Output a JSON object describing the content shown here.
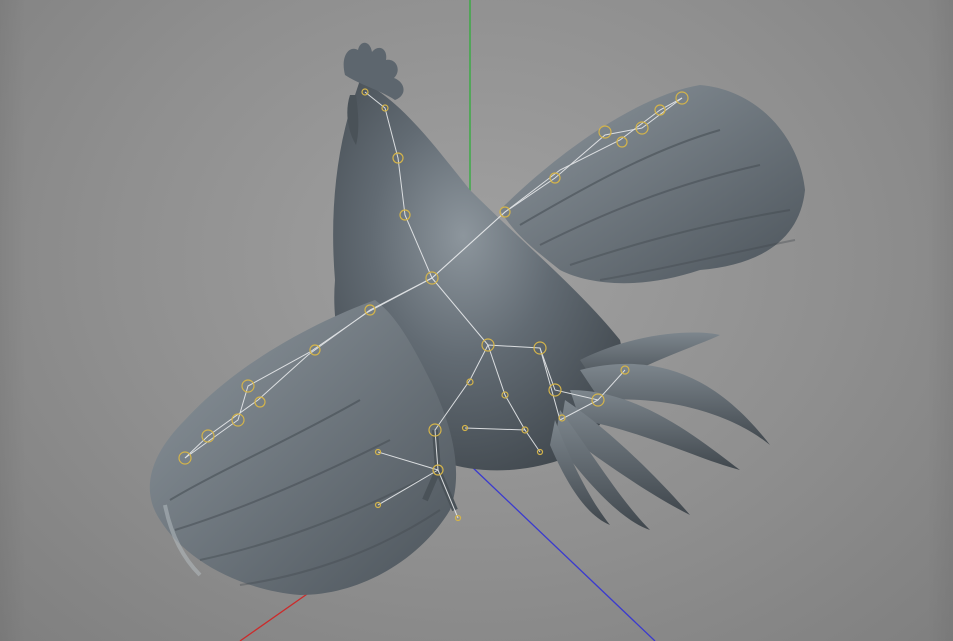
{
  "viewport": {
    "background": "#8f8f8f",
    "axis_colors": {
      "x": "#cc2a2a",
      "y": "#2fae3a",
      "z": "#3a3acf"
    }
  },
  "model": {
    "body_color": "#5a636b",
    "feather_color": "#6a737b",
    "feather_light": "#9aa2a9",
    "rig_line_color": "#e8eaec",
    "joint_color": "#d4b44a"
  }
}
